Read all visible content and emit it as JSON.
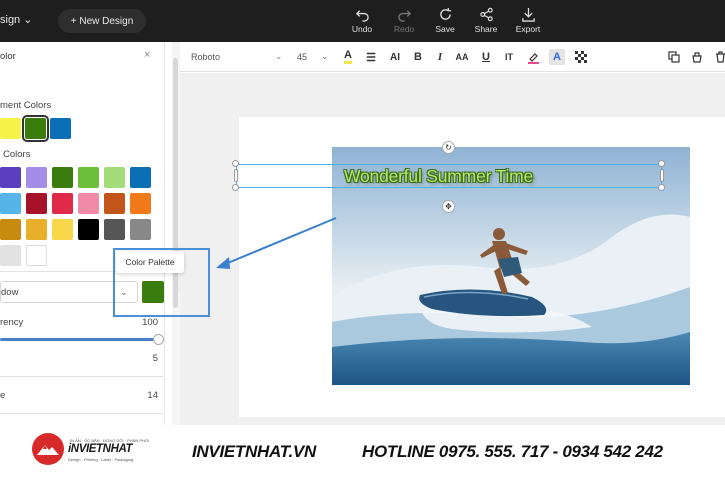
{
  "topbar": {
    "design_menu": "sign ⌄",
    "new_design": "+ New Design",
    "actions": [
      {
        "label": "Undo",
        "icon": "undo-icon"
      },
      {
        "label": "Redo",
        "icon": "redo-icon"
      },
      {
        "label": "Save",
        "icon": "save-icon"
      },
      {
        "label": "Share",
        "icon": "share-icon"
      },
      {
        "label": "Export",
        "icon": "export-icon"
      }
    ]
  },
  "panel": {
    "title": "olor",
    "close": "×",
    "document_colors_label": "ment Colors",
    "default_colors_label": "Colors",
    "document_colors": [
      "#f7f24a",
      "#3a7d0e",
      "#0b6fb6"
    ],
    "default_colors": [
      "#5a3fc0",
      "#a48de8",
      "#3a7d0e",
      "#6cbf3a",
      "#a5dc7a",
      "#0b6fb6",
      "#56b4e8",
      "#a5122a",
      "#e02a4a",
      "#f08aa8",
      "#c2561a",
      "#f07a1a",
      "#c88a10",
      "#e8b02a",
      "#f7d84a",
      "#000000",
      "#555555",
      "#888888",
      "#e2e2e2",
      "#ffffff"
    ],
    "shadow_label": "dow",
    "shadow_color": "#3a7d0e",
    "transparency_label": "rency",
    "transparency_value": "100",
    "row3_value": "5",
    "row4_label": "e",
    "row4_value": "14"
  },
  "tooltip": {
    "text": "Color Palette"
  },
  "format_toolbar": {
    "font": "Roboto",
    "size": "45",
    "icons": [
      "text-color-icon",
      "align-icon",
      "text-case-icon",
      "bold-icon",
      "italic-icon",
      "letter-spacing-icon",
      "underline-icon",
      "line-height-icon",
      "fill-icon",
      "effects-icon",
      "transparency-icon"
    ],
    "right_icons": [
      "duplicate-icon",
      "bucket-icon",
      "delete-icon"
    ]
  },
  "canvas": {
    "headline": "Wonderful Summer Time"
  },
  "footer": {
    "brand": "iNVIETNHAT",
    "brand_top": "IN ẤN · ỐC BẮN · ĐÓNG GÓI · PHÂN PHỐI",
    "brand_sub": "Design · Printing · Label · Packaging",
    "website": "INVIETNHAT.VN",
    "hotline": "HOTLINE 0975. 555. 717 - 0934 542 242"
  },
  "colors": {
    "topbar": "#1e1e1e",
    "accent": "#4a90d9",
    "brand_red": "#d82a2a",
    "headline_fill": "#b6e878",
    "headline_shadow": "#3a6a10"
  }
}
